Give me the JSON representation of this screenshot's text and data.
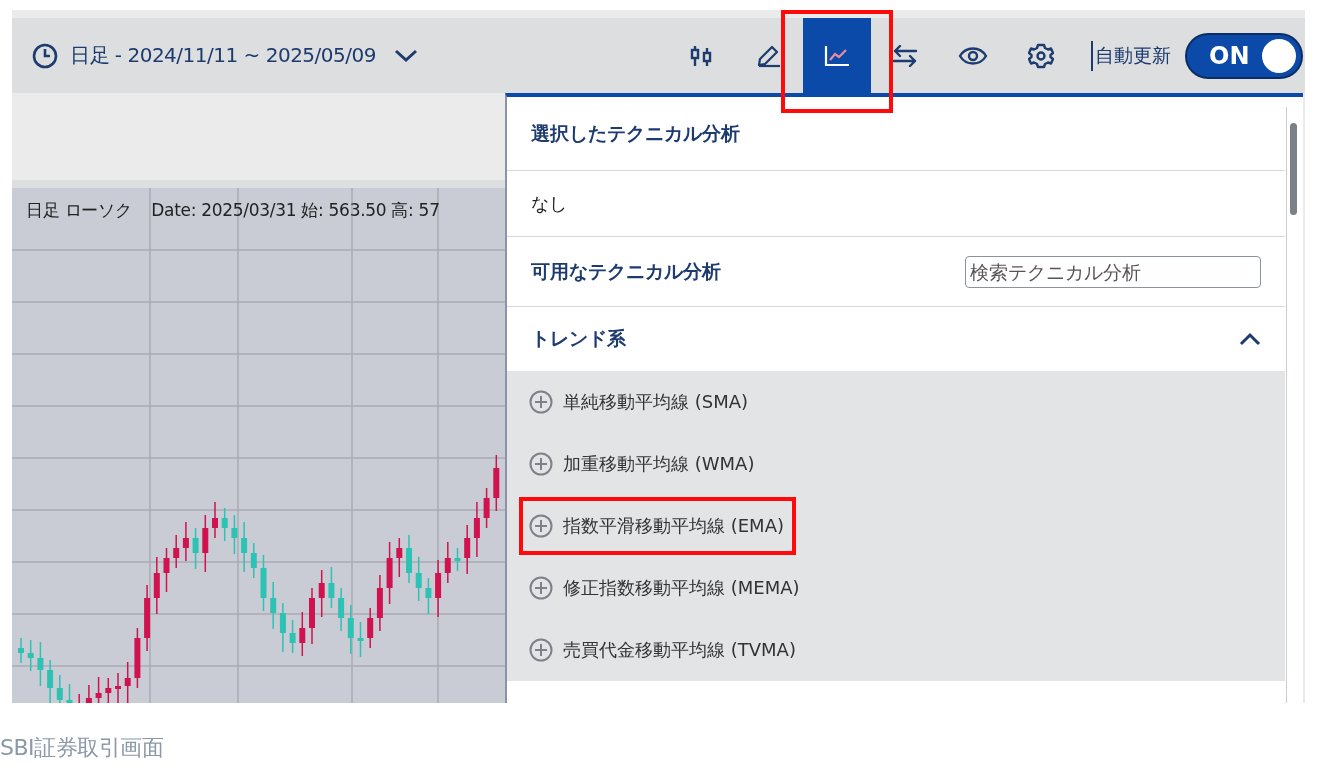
{
  "toolbar": {
    "period": "日足 - 2024/11/11 ~ 2025/05/09",
    "buttons": [
      {
        "kind": "candles",
        "selected": false,
        "highlighted": false
      },
      {
        "kind": "pencil",
        "selected": false,
        "highlighted": false
      },
      {
        "kind": "chart",
        "selected": true,
        "highlighted": true
      },
      {
        "kind": "swap",
        "selected": false,
        "highlighted": false
      },
      {
        "kind": "eye",
        "selected": false,
        "highlighted": false
      },
      {
        "kind": "gear",
        "selected": false,
        "highlighted": false
      }
    ],
    "auto_update": {
      "label": "自動更新",
      "state_label": "ON",
      "on": true
    }
  },
  "chart": {
    "type_label": "日足 ローソク",
    "info": "Date: 2025/03/31 始: 563.50 高: 57"
  },
  "menu": {
    "selected_heading": "選択したテクニカル分析",
    "selected_items": [
      "なし"
    ],
    "available_heading": "可用なテクニカル分析",
    "search": {
      "placeholder": "検索テクニカル分析"
    },
    "groups": [
      {
        "label": "トレンド系",
        "expanded": true,
        "items": [
          {
            "label": "単純移動平均線 (SMA)",
            "highlighted": false
          },
          {
            "label": "加重移動平均線 (WMA)",
            "highlighted": false
          },
          {
            "label": "指数平滑移動平均線 (EMA)",
            "highlighted": true
          },
          {
            "label": "修正指数移動平均線 (MEMA)",
            "highlighted": false
          },
          {
            "label": "売買代金移動平均線 (TVMA)",
            "highlighted": false
          }
        ]
      }
    ]
  },
  "caption": "SBI証券取引画面"
}
